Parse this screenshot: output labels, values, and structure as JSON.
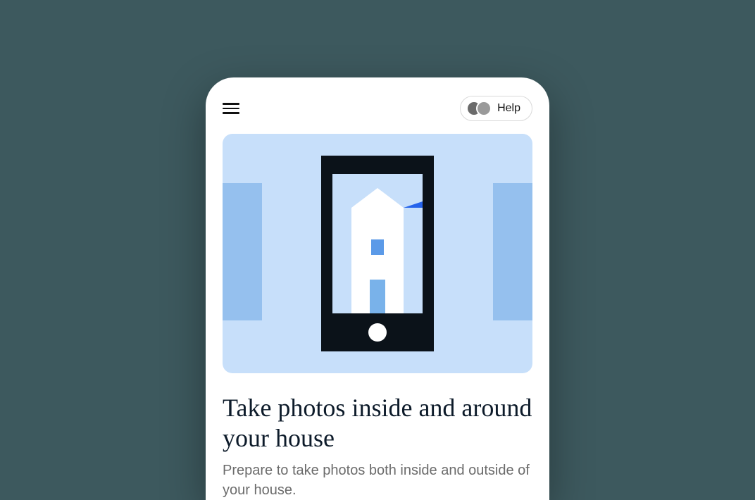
{
  "header": {
    "help_label": "Help"
  },
  "main": {
    "title": "Take photos inside and around your house",
    "subtitle": "Prepare to take photos both inside and outside of your house."
  },
  "icons": {
    "hamburger": "menu-icon",
    "avatar": "avatar-icon",
    "phone_illustration": "phone-house-illustration"
  },
  "colors": {
    "background": "#3d595e",
    "card": "#ffffff",
    "illustration_bg": "#c7dffa",
    "illustration_accent": "#95c0ee",
    "phone_frame": "#0b1219",
    "roof_blue": "#2563eb",
    "title_text": "#0d1b2a",
    "subtitle_text": "#6b6b6b"
  }
}
